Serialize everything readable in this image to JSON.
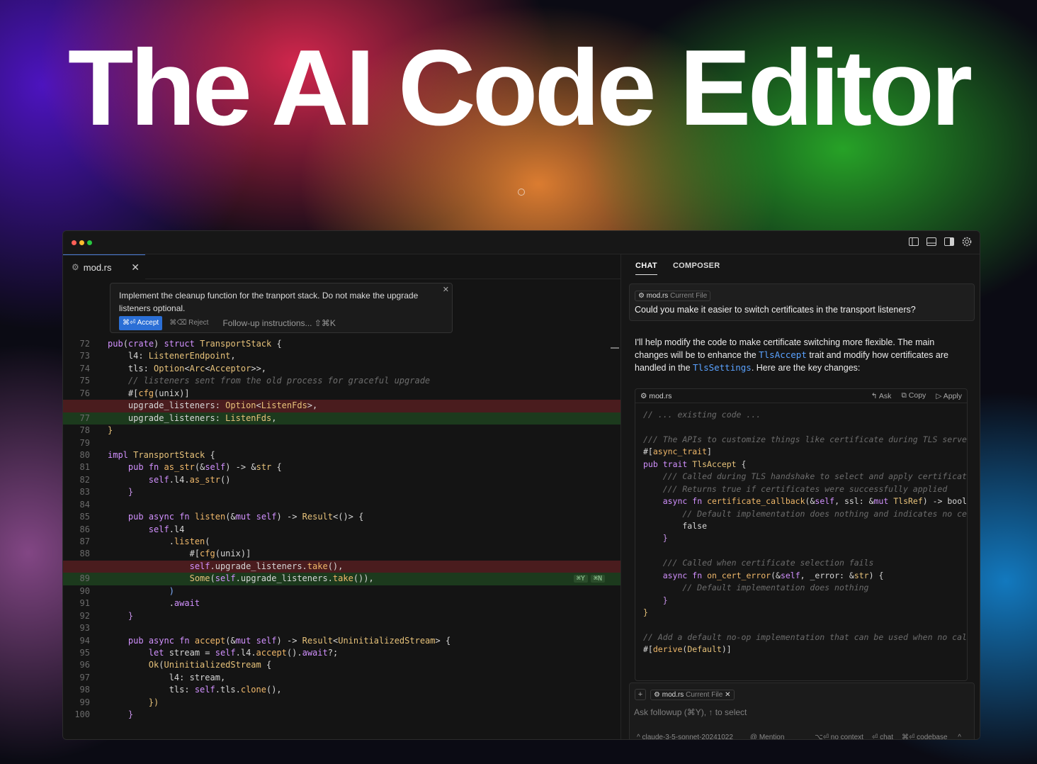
{
  "hero": {
    "title": "The AI Code Editor"
  },
  "editor": {
    "tab": {
      "name": "mod.rs"
    },
    "inline_prompt": {
      "text": "Implement the cleanup function for the tranport stack. Do not make the upgrade listeners optional.",
      "accept": "⌘⏎ Accept",
      "reject": "⌘⌫ Reject",
      "followup": "Follow-up instructions... ⇧⌘K"
    },
    "diff_hint": {
      "yes": "⌘Y",
      "no": "⌘N"
    },
    "line_numbers": [
      "72",
      "73",
      "74",
      "75",
      "76",
      "",
      "77",
      "78",
      "79",
      "80",
      "81",
      "82",
      "83",
      "84",
      "85",
      "86",
      "87",
      "88",
      "",
      "89",
      "90",
      "91",
      "92",
      "93",
      "94",
      "95",
      "96",
      "97",
      "98",
      "99",
      "100"
    ]
  },
  "chat": {
    "tabs": [
      "CHAT",
      "COMPOSER"
    ],
    "user_message": {
      "file": "mod.rs",
      "file_tag": "Current File",
      "text": "Could you make it easier to switch certificates in the transport listeners?"
    },
    "assistant": {
      "p1": "I'll help modify the code to make certificate switching more flexible. The main changes will be to enhance the ",
      "code1": "TlsAccept",
      "p2": " trait and modify how certificates are handled in the ",
      "code2": "TlsSettings",
      "p3": ". Here are the key changes:"
    },
    "code_block": {
      "file": "mod.rs",
      "ask": "Ask",
      "copy": "Copy",
      "apply": "Apply"
    },
    "composer": {
      "file": "mod.rs",
      "file_tag": "Current File",
      "placeholder": "Ask followup (⌘Y), ↑ to select",
      "model": "claude-3-5-sonnet-20241022",
      "mention": "@ Mention",
      "no_context": "⌥⏎ no context",
      "chat": "⏎ chat",
      "codebase": "⌘⏎ codebase"
    }
  },
  "colors": {
    "accent": "#2b6fd6",
    "deleted_line": "#4a1c1e",
    "added_line": "#1c3a1d"
  }
}
